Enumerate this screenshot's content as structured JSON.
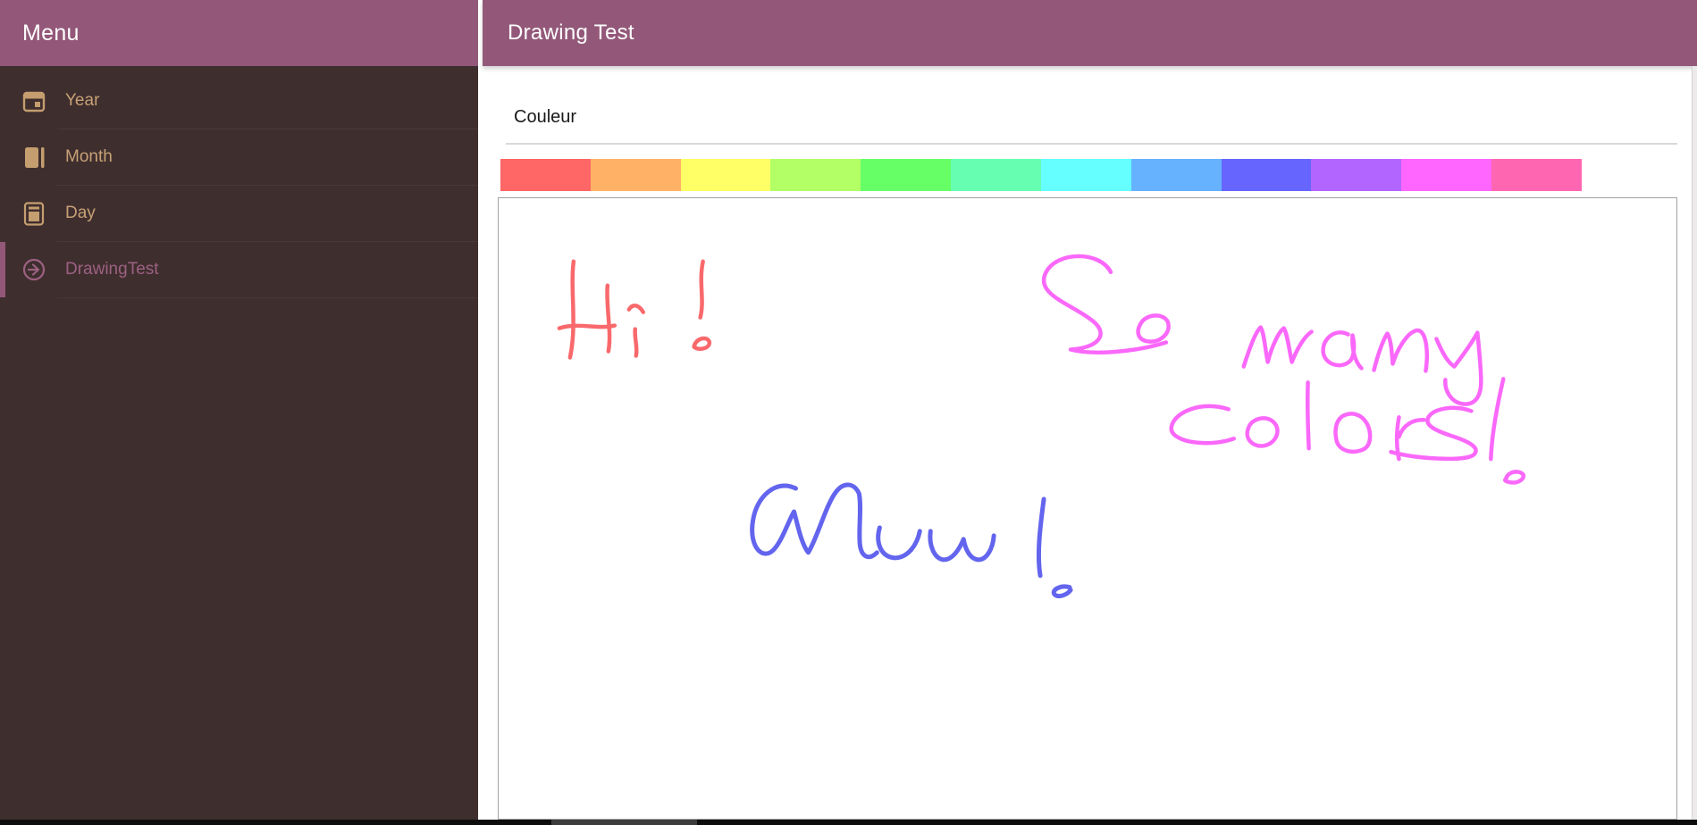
{
  "sidebar": {
    "title": "Menu",
    "items": [
      {
        "label": "Year",
        "icon": "calendar-icon",
        "active": false
      },
      {
        "label": "Month",
        "icon": "book-icon",
        "active": false
      },
      {
        "label": "Day",
        "icon": "journal-icon",
        "active": false
      },
      {
        "label": "DrawingTest",
        "icon": "arrow-right-circle-icon",
        "active": true
      }
    ]
  },
  "header": {
    "title": "Drawing Test"
  },
  "main": {
    "couleur_label": "Couleur",
    "palette": [
      "#ff6666",
      "#ffb266",
      "#ffff66",
      "#b2ff66",
      "#66ff66",
      "#66ffb2",
      "#66ffff",
      "#66b2ff",
      "#6666ff",
      "#b266ff",
      "#ff66ff",
      "#ff66b2"
    ],
    "canvas": {
      "drawings": [
        {
          "text": "Hi !",
          "color": "#f9696c",
          "stroke_width": 4.5,
          "strokes": [
            "M84,71 C80,103 88,141 80,179",
            "M68,146 C90,139 111,148 130,143",
            "M122,98 C120,122 127,150 123,172",
            "M146,125 C151,117 158,121 162,128",
            "M153,147 C152,158 156,167 154,177",
            "M229,71 C224,95 231,114 226,134",
            "M219,167 C220,158 233,154 236,161 C238,168 225,172 219,167"
          ]
        },
        {
          "text": "So many colors !",
          "color": "#fa68fa",
          "stroke_width": 4.5,
          "strokes": [
            "M686,83 C674,59 625,59 613,84 C602,107 637,117 662,135 C686,151 674,168 641,170 C668,177 716,172 748,162",
            "M719,142 C724,130 745,128 750,139 C754,151 742,162 729,161 C717,160 714,151 719,142",
            "M835,189 C841,170 848,150 854,145 C858,151 859,170 862,184 C866,168 874,150 880,146 C884,152 886,171 889,184 C894,171 902,156 911,150",
            "M952,153 C938,146 924,157 924,171 C924,186 943,193 954,183 C960,177 959,162 957,154 C956,168 959,183 967,191",
            "M981,193 C985,177 991,159 996,152 C1000,158 1001,172 1002,186 C1007,170 1017,153 1027,149 C1035,146 1039,156 1040,169 C1041,178 1040,187 1039,194",
            "M1051,158 C1057,172 1063,184 1071,189 C1081,176 1091,162 1097,151 C1099,172 1101,190 1101,206 C1101,223 1094,233 1080,231 C1068,229 1060,217 1061,204",
            "M818,237 C788,227 757,240 754,257 C751,273 793,281 824,270",
            "M840,259 C843,247 861,243 869,252 C877,260 872,275 858,278 C844,280 836,269 840,259",
            "M907,207 C906,232 907,258 908,281",
            "M950,243 C939,246 936,259 939,272 C942,285 960,288 971,281 C979,275 978,259 971,250 C965,242 956,241 950,243",
            "M1009,246 C1006,262 1006,279 1009,293 M1009,268 C1013,256 1024,248 1037,249",
            "M1090,239 C1071,232 1048,236 1042,246 C1037,255 1050,261 1068,267 C1090,274 1100,281 1093,288 C1084,296 1030,293 1000,285",
            "M1126,203 C1119,233 1113,267 1112,293",
            "M1129,315 C1131,307 1143,305 1148,310 C1151,315 1142,321 1133,319 C1128,318 1127,317 1129,315"
          ]
        },
        {
          "text": "Wow !",
          "color": "#6365ee",
          "stroke_width": 5,
          "strokes": [
            "M333,326 C311,315 289,335 285,362 C280,393 297,408 309,394 C319,382 325,362 331,352 C335,366 339,388 347,398 C357,382 367,344 378,330 C387,318 399,320 404,332 C407,348 403,374 405,390 C407,403 415,407 424,398",
            "M427,370 C422,388 429,403 444,404 C459,404 469,389 472,374",
            "M484,374 C482,390 488,404 498,406 C508,407 516,395 521,383 C523,394 528,405 537,406 C547,407 554,393 555,379",
            "M611,338 C607,368 603,400 607,424",
            "M640,437 C630,434 619,440 623,445 C627,449 637,446 641,440"
          ]
        }
      ]
    }
  },
  "colors": {
    "header_bg": "#935879",
    "sidebar_bg": "#3f2e2e",
    "sidebar_divider": "#4a3838",
    "item_fg": "#c7a176",
    "icon_fg": "#c49e6f",
    "active_fg": "#9c6182",
    "accent": "#935879",
    "canvas_border": "#a3a0a0",
    "rule": "#d8d8d8",
    "bottom_bar": "#0d0d0d",
    "bottom_thumb": "#3c3c3c"
  }
}
